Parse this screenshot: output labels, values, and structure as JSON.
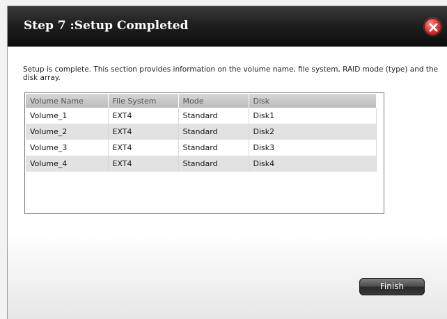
{
  "dialog": {
    "title": "Step 7 :Setup Completed",
    "close_icon": "close-icon",
    "description": "Setup is complete. This section provides information on the volume name, file system, RAID mode (type) and the disk array.",
    "finish_label": "Finish"
  },
  "table": {
    "columns": [
      "Volume Name",
      "File System",
      "Mode",
      "Disk"
    ],
    "rows": [
      [
        "Volume_1",
        "EXT4",
        "Standard",
        "Disk1"
      ],
      [
        "Volume_2",
        "EXT4",
        "Standard",
        "Disk2"
      ],
      [
        "Volume_3",
        "EXT4",
        "Standard",
        "Disk3"
      ],
      [
        "Volume_4",
        "EXT4",
        "Standard",
        "Disk4"
      ]
    ]
  },
  "colors": {
    "titlebar": "#1a1a1a",
    "close_button": "#d93030",
    "row_alt": "#e2e2e2",
    "header": "#c8c8c8"
  }
}
